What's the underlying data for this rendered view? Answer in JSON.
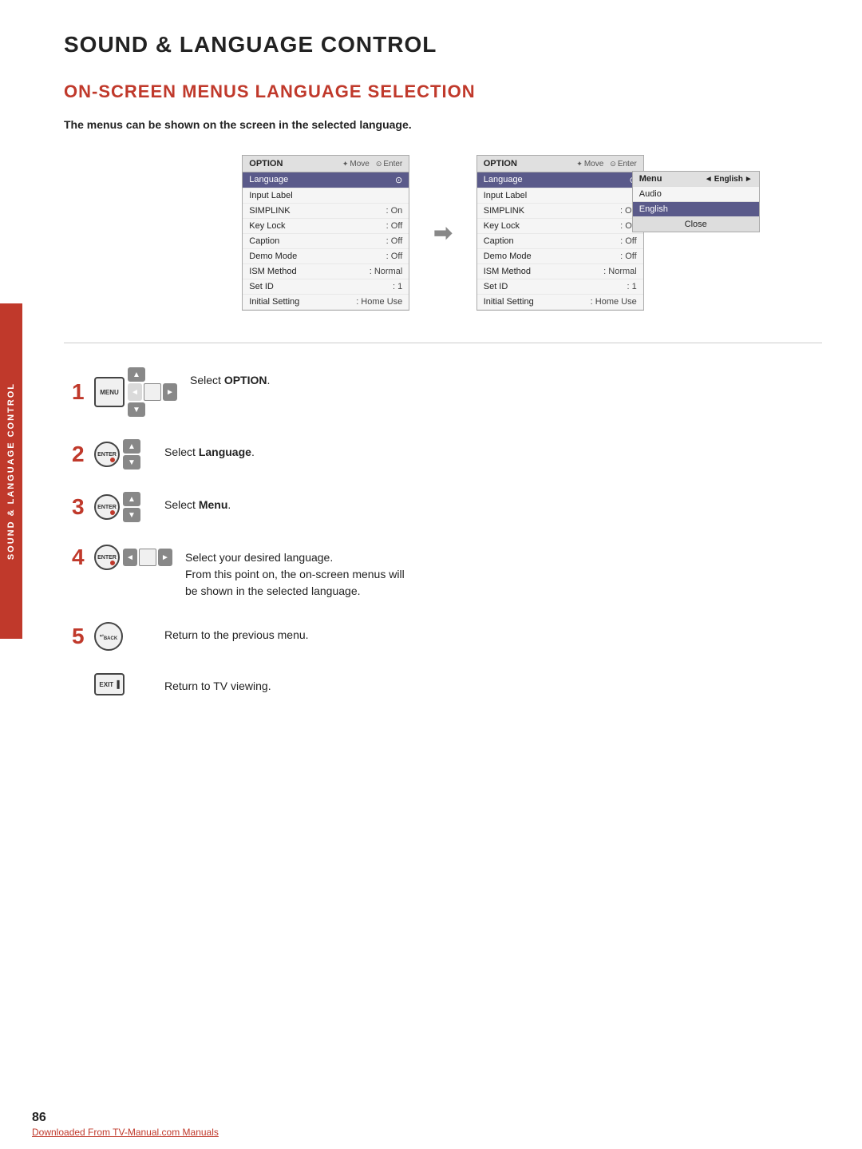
{
  "page": {
    "title": "SOUND & LANGUAGE CONTROL",
    "section_title": "ON-SCREEN MENUS LANGUAGE SELECTION",
    "intro": "The menus can be shown on the screen in the selected language.",
    "side_tab": "SOUND & LANGUAGE CONTROL",
    "page_number": "86",
    "footer_link": "Downloaded From TV-Manual.com Manuals"
  },
  "menu_left": {
    "title": "OPTION",
    "nav_move": "Move",
    "nav_enter": "Enter",
    "rows": [
      {
        "label": "Language",
        "value": "",
        "highlighted": true
      },
      {
        "label": "Input Label",
        "value": ""
      },
      {
        "label": "SIMPLINK",
        "value": ": On"
      },
      {
        "label": "Key Lock",
        "value": ": Off"
      },
      {
        "label": "Caption",
        "value": ": Off"
      },
      {
        "label": "Demo Mode",
        "value": ": Off"
      },
      {
        "label": "ISM Method",
        "value": ": Normal"
      },
      {
        "label": "Set ID",
        "value": ": 1"
      },
      {
        "label": "Initial Setting",
        "value": ": Home Use"
      }
    ]
  },
  "menu_right": {
    "title": "OPTION",
    "nav_move": "Move",
    "nav_enter": "Enter",
    "rows": [
      {
        "label": "Language",
        "value": "",
        "highlighted": true
      },
      {
        "label": "Input Label",
        "value": ""
      },
      {
        "label": "SIMPLINK",
        "value": ": On"
      },
      {
        "label": "Key Lock",
        "value": ": Off"
      },
      {
        "label": "Caption",
        "value": ": Off"
      },
      {
        "label": "Demo Mode",
        "value": ": Off"
      },
      {
        "label": "ISM Method",
        "value": ": Normal"
      },
      {
        "label": "Set ID",
        "value": ": 1"
      },
      {
        "label": "Initial Setting",
        "value": ": Home Use"
      }
    ],
    "submenu": {
      "menu_label": "Menu",
      "audio_label": "Audio",
      "english_selected": "English",
      "close_label": "Close"
    }
  },
  "steps": [
    {
      "number": "1",
      "button_type": "menu_dpad",
      "text": "Select <strong>OPTION</strong>."
    },
    {
      "number": "2",
      "button_type": "enter_vdpad",
      "text": "Select <strong>Language</strong>."
    },
    {
      "number": "3",
      "button_type": "enter_vdpad",
      "text": "Select <strong>Menu</strong>."
    },
    {
      "number": "4",
      "button_type": "enter_hlrdpad",
      "text": "Select your desired language.\nFrom this point on, the on-screen menus will be shown in the selected language."
    },
    {
      "number": "5",
      "button_type": "back",
      "text": "Return to the previous menu."
    },
    {
      "number": "",
      "button_type": "exit",
      "text": "Return to TV viewing."
    }
  ]
}
